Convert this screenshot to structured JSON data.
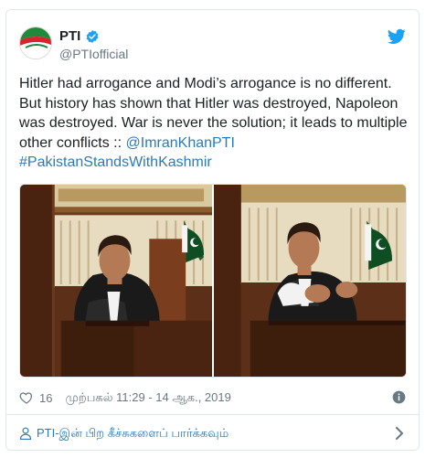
{
  "account": {
    "display_name": "PTI",
    "handle": "@PTIofficial",
    "verified": true
  },
  "tweet": {
    "text": "Hitler had arrogance and Modi’s arrogance is no different. But history has shown that Hitler was destroyed, Napoleon was destroyed. War is never the solution; it leads to multiple other conflicts :: ",
    "mention": "@ImranKhanPTI",
    "hashtag": "#PakistanStandsWithKashmir"
  },
  "meta": {
    "like_count": "16",
    "timestamp": "முற்பகல் 11:29 - 14 ஆக., 2019"
  },
  "footer": {
    "label": "PTI-இன் பிற கீச்சுகளைப் பார்க்கவும்"
  },
  "icons": {
    "verified": "verified-badge-icon",
    "brand": "twitter-bird-icon",
    "like": "heart-icon",
    "info": "info-icon",
    "person": "person-icon",
    "chevron": "chevron-right-icon"
  },
  "colors": {
    "link": "#2b7bb9",
    "verified": "#1da1f2",
    "muted": "#697882",
    "border": "#e1e8ed"
  }
}
